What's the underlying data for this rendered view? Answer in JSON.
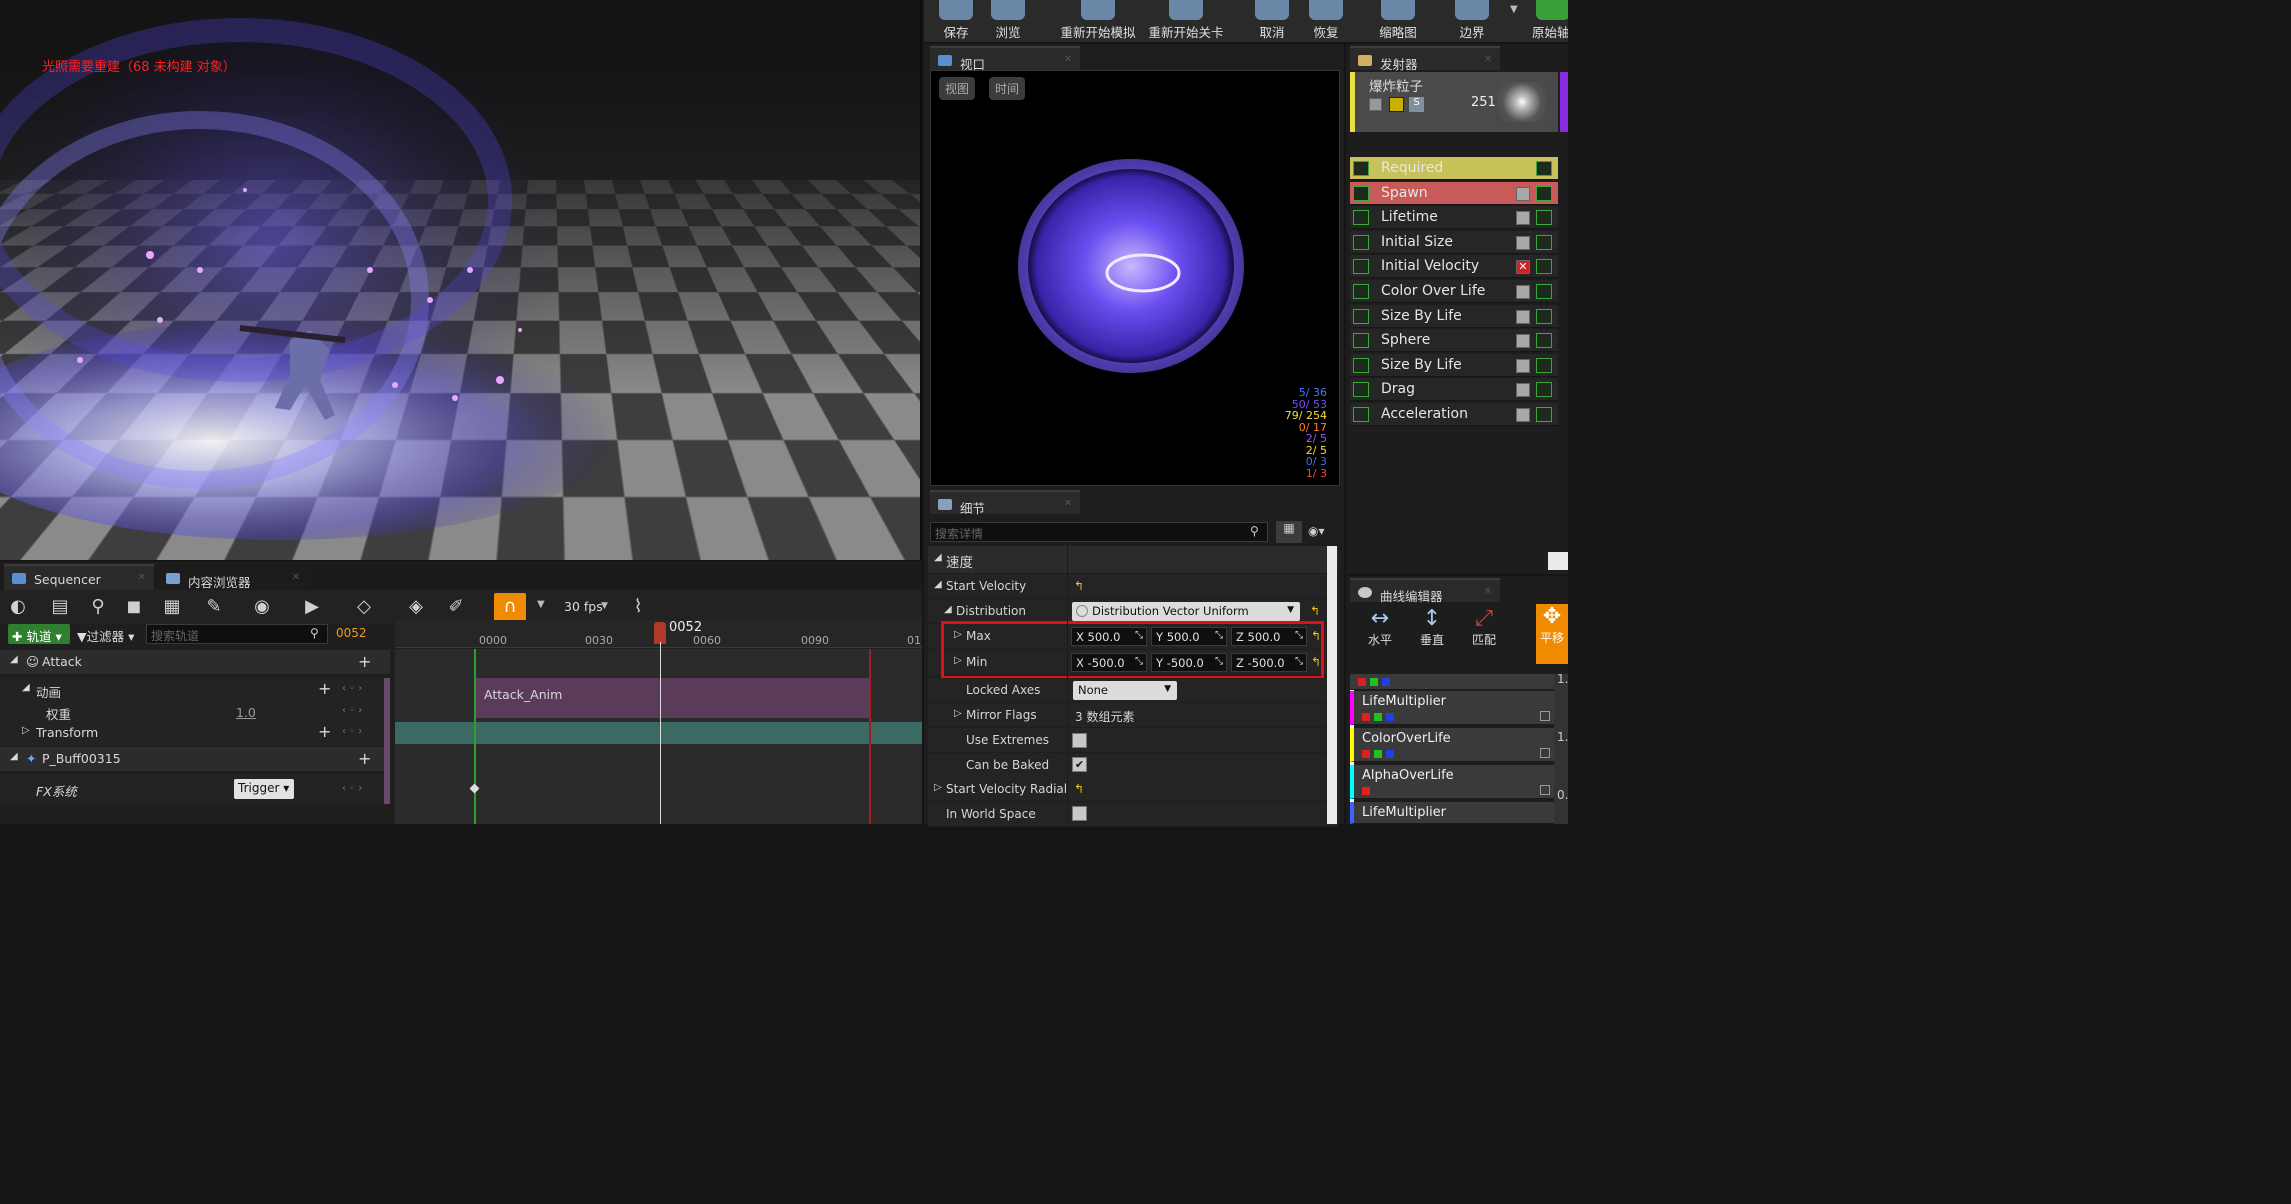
{
  "viewport3d": {
    "warning": "光照需要重建（68 未构建 对象）"
  },
  "toolbar_top": {
    "buttons": [
      "保存",
      "浏览",
      "重新开始模拟",
      "重新开始关卡",
      "取消",
      "恢复",
      "缩略图",
      "边界",
      "原始轴"
    ]
  },
  "preview_viewport": {
    "tab": "视口",
    "btn_view": "视图",
    "btn_time": "时间",
    "stats": [
      "5/ 36",
      "50/ 53",
      "79/ 254",
      "0/ 17",
      "2/ 5",
      "2/ 5",
      "0/ 3",
      "1/ 3"
    ],
    "stat_colors": [
      "#3d7bff",
      "#7a4dff",
      "#ffdd33",
      "#ff7f2a",
      "#9a5bff",
      "#ffdd33",
      "#3d6bff",
      "#ff4040"
    ]
  },
  "emitters": {
    "tab": "发射器",
    "emitter_name": "爆炸粒子",
    "emitter_count": "251",
    "modules": [
      {
        "name": "Required",
        "state": "required"
      },
      {
        "name": "Spawn",
        "state": "spawn"
      },
      {
        "name": "Lifetime",
        "state": "normal"
      },
      {
        "name": "Initial Size",
        "state": "normal"
      },
      {
        "name": "Initial Velocity",
        "state": "error"
      },
      {
        "name": "Color Over Life",
        "state": "normal"
      },
      {
        "name": "Size By Life",
        "state": "normal"
      },
      {
        "name": "Sphere",
        "state": "normal"
      },
      {
        "name": "Size By Life",
        "state": "normal"
      },
      {
        "name": "Drag",
        "state": "normal"
      },
      {
        "name": "Acceleration",
        "state": "normal"
      }
    ]
  },
  "details": {
    "tab": "细节",
    "search_placeholder": "搜索详情",
    "category": "速度",
    "start_velocity": "Start Velocity",
    "distribution_label": "Distribution",
    "distribution_value": "Distribution Vector Uniform",
    "max": {
      "label": "Max",
      "x": "500.0",
      "y": "500.0",
      "z": "500.0"
    },
    "min": {
      "label": "Min",
      "x": "-500.0",
      "y": "-500.0",
      "z": "-500.0"
    },
    "axis_x": "X",
    "axis_y": "Y",
    "axis_z": "Z",
    "locked_axes_label": "Locked Axes",
    "locked_axes_value": "None",
    "mirror_flags_label": "Mirror Flags",
    "mirror_flags_value": "3 数组元素",
    "use_extremes_label": "Use Extremes",
    "use_extremes": false,
    "can_be_baked_label": "Can be Baked",
    "can_be_baked": true,
    "start_velocity_radial": "Start Velocity Radial",
    "in_world_space": "In World Space"
  },
  "curve_editor": {
    "tab": "曲线编辑器",
    "buttons": [
      "水平",
      "垂直",
      "匹配",
      "平移"
    ],
    "curves": [
      "LifeMultiplier",
      "ColorOverLife",
      "AlphaOverLife",
      "LifeMultiplier"
    ],
    "side_values": [
      "1.",
      "1.",
      "0."
    ]
  },
  "sequencer": {
    "tab": "Sequencer",
    "tab2": "内容浏览器",
    "fps": "30 fps",
    "track_btn": "轨道",
    "filter_btn": "过滤器",
    "search_placeholder": "搜索轨道",
    "current_frame": "0052",
    "playhead": "0052",
    "ticks": [
      "0000",
      "0030",
      "0060",
      "0090",
      "01"
    ],
    "tracks": {
      "attack": "Attack",
      "anim": "动画",
      "weight": "权重",
      "weight_value": "1.0",
      "transform": "Transform",
      "buff": "P_Buff00315",
      "fx": "FX系统",
      "trigger": "Trigger"
    },
    "clip": "Attack_Anim"
  }
}
